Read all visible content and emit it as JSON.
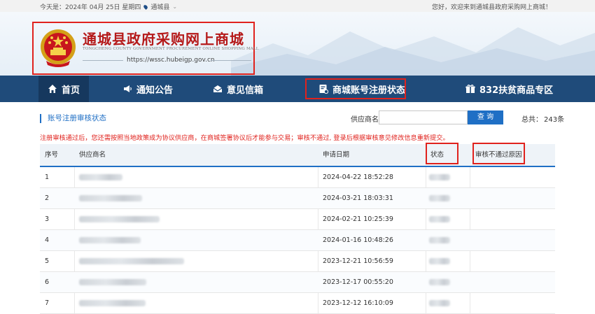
{
  "topbar": {
    "date_text": "今天是：2024年 04月 25日 星期四",
    "location": "通城县",
    "welcome": "您好，欢迎来到通城县政府采购网上商城！"
  },
  "header": {
    "title_cn": "通城县政府采购网上商城",
    "title_en": "TONGCHENG COUNTY GOVERNMENT PROCUREMENT ONLINE SHOPPING MALL",
    "url": "https://wssc.hubeigp.gov.cn"
  },
  "nav": {
    "items": [
      {
        "label": "首页",
        "icon": "home-icon"
      },
      {
        "label": "通知公告",
        "icon": "megaphone-icon"
      },
      {
        "label": "意见信箱",
        "icon": "mail-icon"
      },
      {
        "label": "商城账号注册状态",
        "icon": "registration-icon"
      },
      {
        "label": "832扶贫商品专区",
        "icon": "gift-icon"
      }
    ]
  },
  "content": {
    "section_title": "账号注册审核状态",
    "search_label": "供应商名:",
    "search_value": "",
    "search_placeholder": "",
    "search_button": "查 询",
    "total_label": "总共：",
    "total_value": "243条",
    "notice": "注册审核通过后，您还需按照当地政策成为协议供应商，在商城签署协议后才能参与交易；审核不通过, 登录后根据审核意见修改信息重新提交。"
  },
  "table": {
    "headers": [
      "序号",
      "供应商名",
      "申请日期",
      "状态",
      "审核不通过原因"
    ],
    "rows": [
      {
        "no": "1",
        "date": "2024-04-22 18:52:28"
      },
      {
        "no": "2",
        "date": "2024-03-21 18:03:31"
      },
      {
        "no": "3",
        "date": "2024-02-21 10:25:39"
      },
      {
        "no": "4",
        "date": "2024-01-16 10:48:26"
      },
      {
        "no": "5",
        "date": "2023-12-21 10:56:59"
      },
      {
        "no": "6",
        "date": "2023-12-17 00:55:20"
      },
      {
        "no": "7",
        "date": "2023-12-12 16:10:09"
      }
    ]
  },
  "colors": {
    "nav_bg": "#1f4b7a",
    "accent_blue": "#1f6fc5",
    "highlight_red": "#e0221d",
    "title_red": "#b51a1a"
  }
}
